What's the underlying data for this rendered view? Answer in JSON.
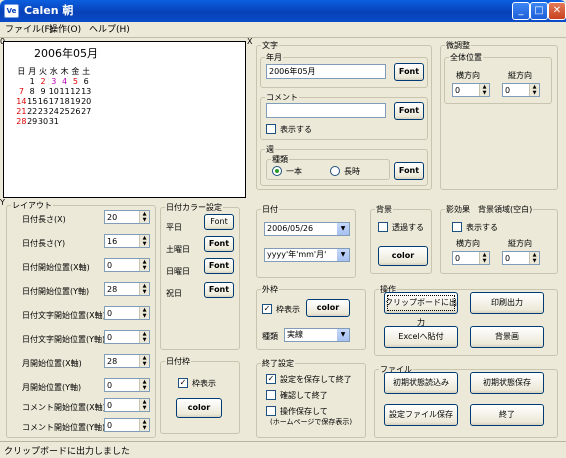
{
  "window": {
    "title": "Calen 朝",
    "icon": "Ve",
    "minimize": "_",
    "maximize": "□",
    "close": "✕"
  },
  "menu": [
    "ファイル(F)",
    "操作(O)",
    "ヘルプ(H)"
  ],
  "calendar": {
    "month_title": "2006年05月",
    "weekdays": [
      "日",
      "月",
      "火",
      "水",
      "木",
      "金",
      "土"
    ],
    "weeks": [
      [
        "",
        "1",
        "2",
        "3",
        "4",
        "5",
        "6"
      ],
      [
        "7",
        "8",
        "9",
        "10",
        "11",
        "12",
        "13"
      ],
      [
        "14",
        "15",
        "16",
        "17",
        "18",
        "19",
        "20"
      ],
      [
        "21",
        "22",
        "23",
        "24",
        "25",
        "26",
        "27"
      ],
      [
        "28",
        "29",
        "30",
        "31",
        "",
        "",
        ""
      ]
    ]
  },
  "markers": {
    "top_left": "0",
    "top_right": "X",
    "left_mid": "Y"
  },
  "layout": {
    "legend": "レイアウト",
    "rows": [
      {
        "label": "日付長さ(X)",
        "value": "20"
      },
      {
        "label": "日付長さ(Y)",
        "value": "16"
      },
      {
        "label": "日付開始位置(X軸)",
        "value": "0"
      },
      {
        "label": "日付開始位置(Y軸)",
        "value": "28"
      },
      {
        "label": "日付文字開始位置(X軸)",
        "value": "0"
      },
      {
        "label": "日付文字開始位置(Y軸)",
        "value": "0"
      },
      {
        "label": "月開始位置(X軸)",
        "value": "28"
      },
      {
        "label": "月開始位置(Y軸)",
        "value": "0"
      },
      {
        "label": "コメント開始位置(X軸)",
        "value": "0"
      },
      {
        "label": "コメント開始位置(Y軸)",
        "value": "0"
      }
    ]
  },
  "day_colors": {
    "legend": "日付カラー設定",
    "rows": [
      {
        "label": "平日",
        "button": "Font"
      },
      {
        "label": "土曜日",
        "button": "Font"
      },
      {
        "label": "日曜日",
        "button": "Font"
      },
      {
        "label": "祝日",
        "button": "Font"
      }
    ]
  },
  "date_frame": {
    "legend": "日付枠",
    "checkbox": "枠表示",
    "button": "color"
  },
  "text": {
    "legend": "文字",
    "year_month": {
      "legend": "年月",
      "value": "2006年05月",
      "button": "Font"
    },
    "comment": {
      "legend": "コメント",
      "value": "",
      "button": "Font",
      "checkbox": "表示する"
    },
    "week": {
      "legend": "週",
      "sub": "種類",
      "opt1": "一本",
      "opt2": "長時",
      "button": "Font"
    }
  },
  "adjust": {
    "legend": "微調整",
    "sub": "全体位置",
    "x_label": "横方向",
    "y_label": "縦方向",
    "x_value": "0",
    "y_value": "0"
  },
  "date": {
    "legend": "日付",
    "date_value": "2006/05/26",
    "format_value": "yyyy'年'mm'月'"
  },
  "background": {
    "legend": "背景",
    "checkbox": "透過する",
    "button": "color"
  },
  "shadow": {
    "legend": "影効果　背景領域(空白)",
    "checkbox": "表示する",
    "x_label": "横方向",
    "y_label": "縦方向",
    "x_value": "0",
    "y_value": "0"
  },
  "outer_frame": {
    "legend": "外枠",
    "checkbox": "枠表示",
    "button": "color",
    "type_label": "種類",
    "type_value": "実線"
  },
  "exit": {
    "legend": "終了設定",
    "opt1": "設定を保存して終了",
    "opt2": "確認して終了",
    "opt3": "操作保存して",
    "opt3b": "(ホームページで保存表示)"
  },
  "operation": {
    "legend": "操作",
    "buttons": [
      "クリップボードに出力",
      "印刷出力",
      "Excelへ貼付",
      "背景画"
    ]
  },
  "file": {
    "legend": "ファイル",
    "buttons": [
      "初期状態読込み",
      "初期状態保存",
      "設定ファイル保存",
      "終了"
    ]
  },
  "status": "クリップボードに出力しました"
}
